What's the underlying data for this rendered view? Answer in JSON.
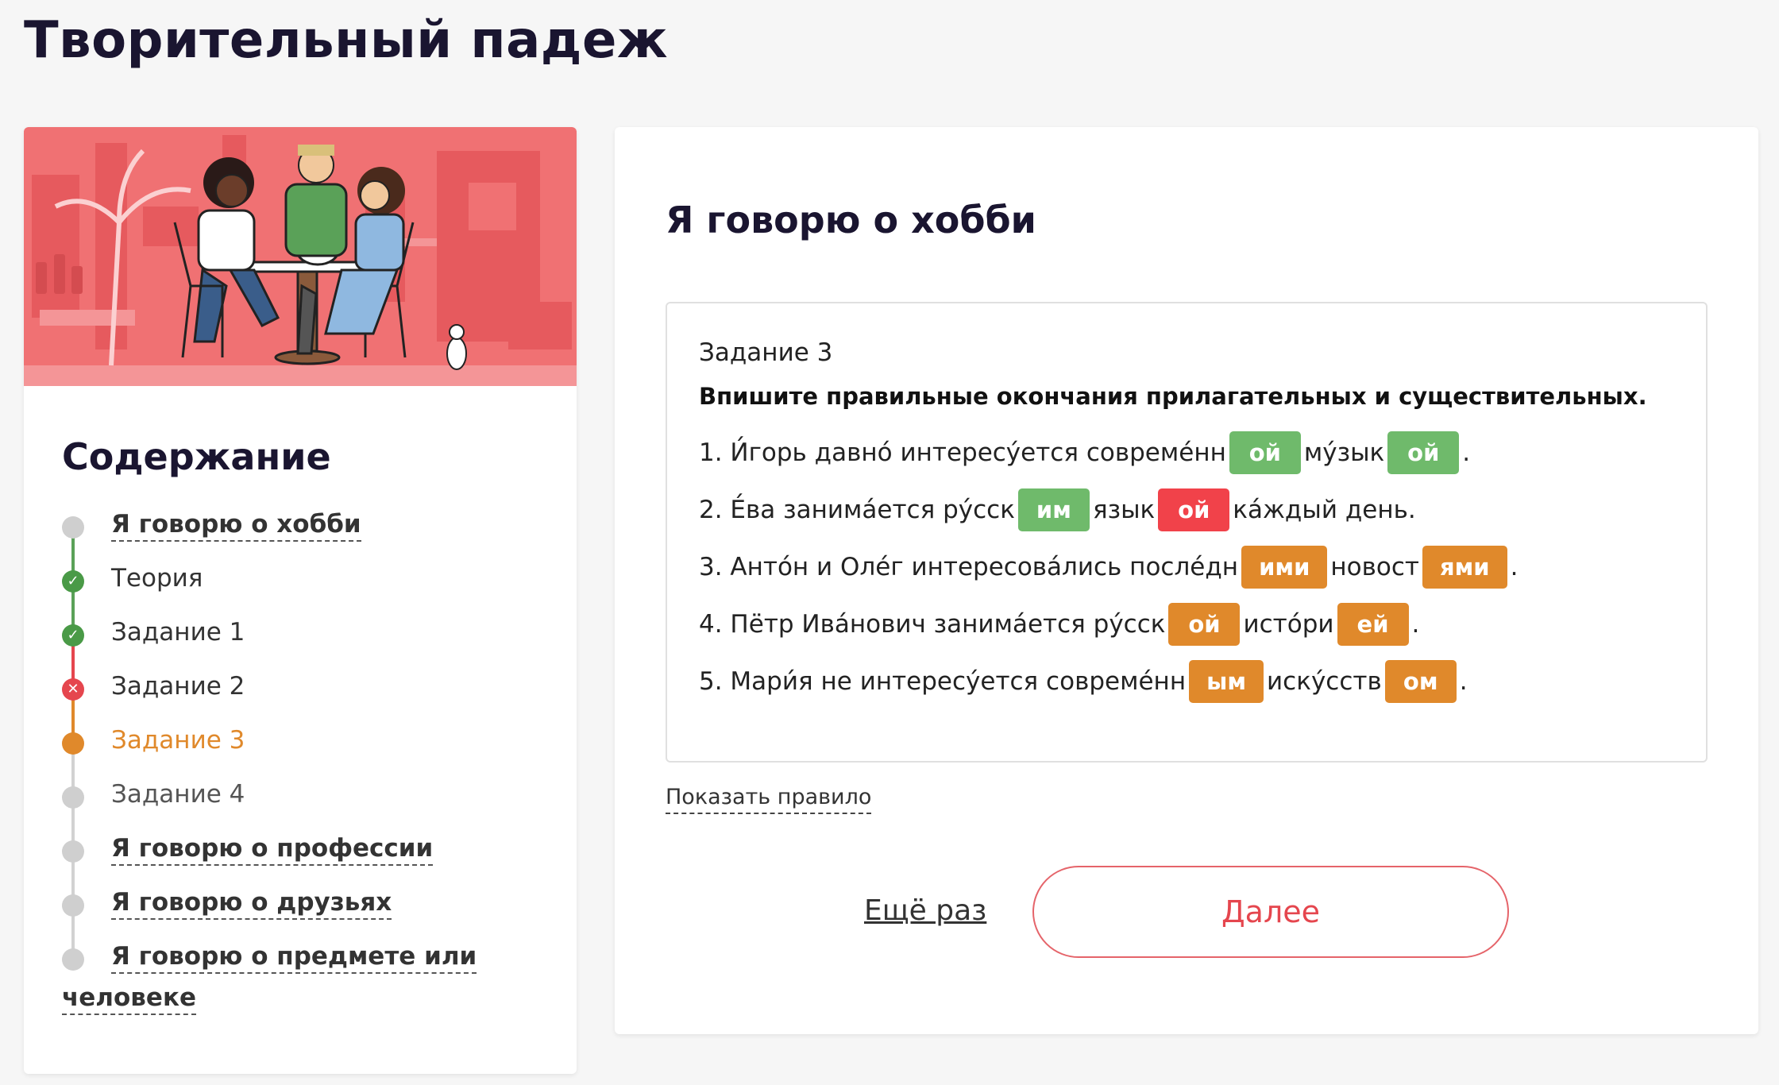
{
  "page_title": "Творительный падеж",
  "sidebar": {
    "toc_title": "Содержание",
    "items": [
      {
        "label": "Я говорю о хобби",
        "status": "link"
      },
      {
        "label": "Теория",
        "status": "done"
      },
      {
        "label": "Задание 1",
        "status": "done"
      },
      {
        "label": "Задание 2",
        "status": "failed"
      },
      {
        "label": "Задание 3",
        "status": "current"
      },
      {
        "label": "Задание 4",
        "status": "pending"
      },
      {
        "label": "Я говорю о профессии",
        "status": "link"
      },
      {
        "label": "Я говорю о друзьях",
        "status": "link"
      },
      {
        "label": "Я говорю о предмете или человеке",
        "status": "link",
        "label_line1": "Я говорю о предмете или",
        "label_line2": "человеке"
      }
    ]
  },
  "main": {
    "section_title": "Я говорю о хобби",
    "task": {
      "number": "Задание 3",
      "instruction": "Впишите правильные окончания прилагательных и существительных.",
      "sentences": [
        {
          "parts": [
            "1. И́горь давно́ интересу́ется совреме́нн",
            "ой",
            " му́зык",
            "ой",
            "."
          ],
          "states": [
            "text",
            "correct",
            "text",
            "correct",
            "text"
          ]
        },
        {
          "parts": [
            "2. Е́ва занима́ется ру́сск",
            "им",
            " язык",
            "ой",
            " ка́ждый день."
          ],
          "states": [
            "text",
            "correct",
            "text",
            "wrong",
            "text"
          ]
        },
        {
          "parts": [
            "3. Анто́н и Оле́г интересова́лись после́дн",
            "ими",
            " новост",
            "ями",
            "."
          ],
          "states": [
            "text",
            "answer",
            "text",
            "answer",
            "text"
          ]
        },
        {
          "parts": [
            "4. Пётр Ива́нович занима́ется ру́сск",
            "ой",
            " исто́ри",
            "ей",
            "."
          ],
          "states": [
            "text",
            "answer",
            "text",
            "answer",
            "text"
          ]
        },
        {
          "parts": [
            "5. Мари́я не интересу́ется совреме́нн",
            "ым",
            " иску́сств",
            "ом",
            "."
          ],
          "states": [
            "text",
            "answer",
            "text",
            "answer",
            "text"
          ]
        }
      ]
    },
    "show_rule": "Показать правило",
    "retry": "Ещё раз",
    "next": "Далее"
  },
  "colors": {
    "correct": "#6fba6b",
    "wrong": "#f1424a",
    "answer": "#e0892b",
    "accent": "#e5464e",
    "illustration_bg": "#f07173"
  }
}
